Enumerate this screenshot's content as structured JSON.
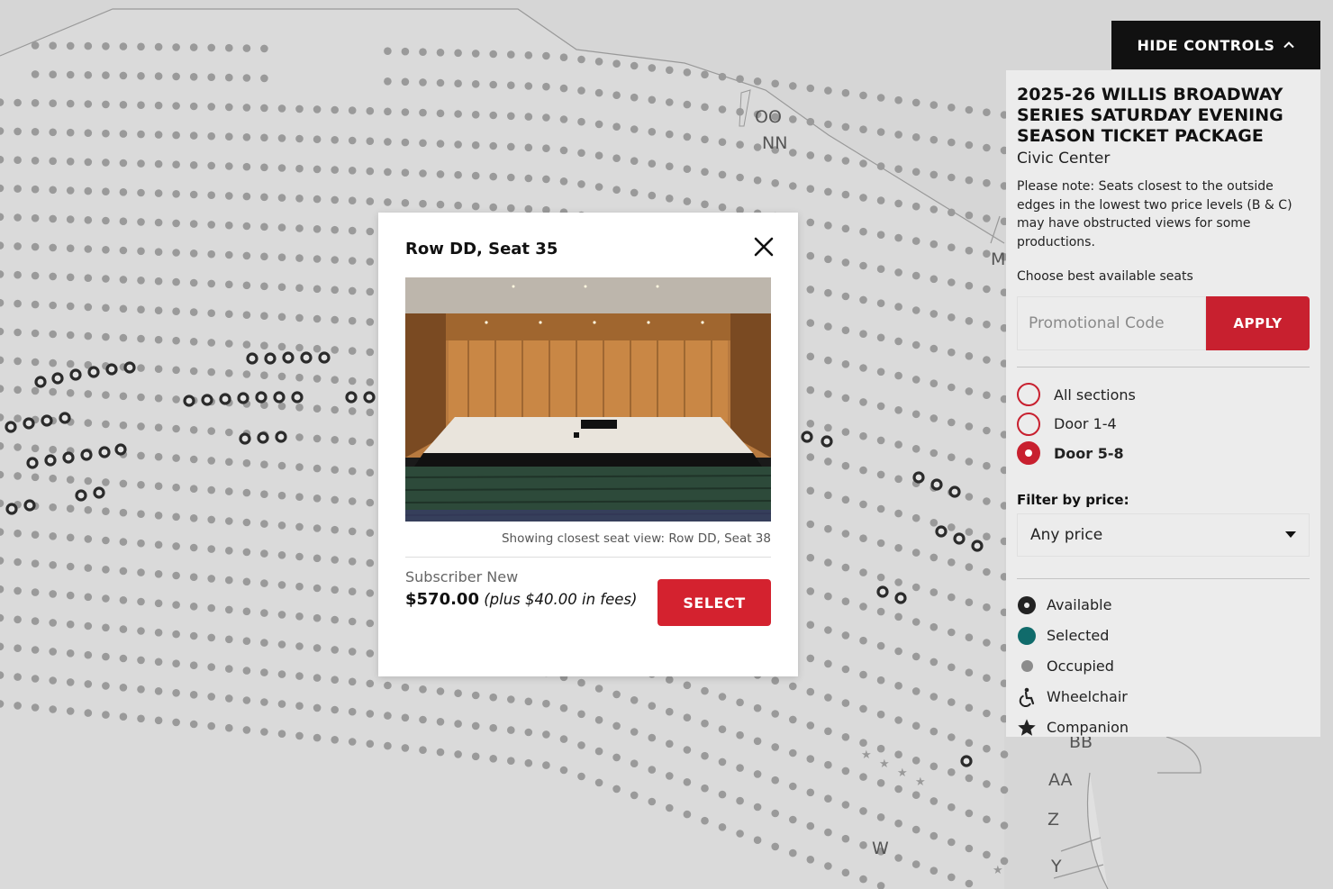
{
  "controls": {
    "hide_label": "HIDE CONTROLS"
  },
  "event": {
    "title": "2025-26 WILLIS BROADWAY SERIES SATURDAY EVENING SEASON TICKET PACKAGE",
    "venue": "Civic Center",
    "note": "Please note: Seats closest to the outside edges in the lowest two price levels (B & C) may have obstructed views for some productions.",
    "choose_label": "Choose best available seats"
  },
  "promo": {
    "placeholder": "Promotional Code",
    "apply_label": "APPLY"
  },
  "sections": [
    {
      "label": "All sections",
      "selected": false
    },
    {
      "label": "Door 1-4",
      "selected": false
    },
    {
      "label": "Door 5-8",
      "selected": true
    }
  ],
  "price_filter": {
    "label": "Filter by price:",
    "value": "Any price"
  },
  "legend": [
    {
      "label": "Available",
      "icon": "available-icon"
    },
    {
      "label": "Selected",
      "icon": "selected-icon",
      "color": "#106b6b"
    },
    {
      "label": "Occupied",
      "icon": "occupied-icon"
    },
    {
      "label": "Wheelchair",
      "icon": "wheelchair-icon"
    },
    {
      "label": "Companion",
      "icon": "star-icon"
    }
  ],
  "row_labels": [
    "OO",
    "NN",
    "M",
    "BB",
    "AA",
    "Z",
    "Y",
    "W"
  ],
  "popup": {
    "title": "Row DD, Seat 35",
    "caption": "Showing closest seat view: Row DD, Seat 38",
    "price_type": "Subscriber New",
    "price": "$570.00",
    "fees": "(plus $40.00 in fees)",
    "select_label": "SELECT"
  },
  "colors": {
    "accent": "#c8202f",
    "selected": "#106b6b",
    "occupied": "#8c8c8c",
    "available": "#222222"
  }
}
